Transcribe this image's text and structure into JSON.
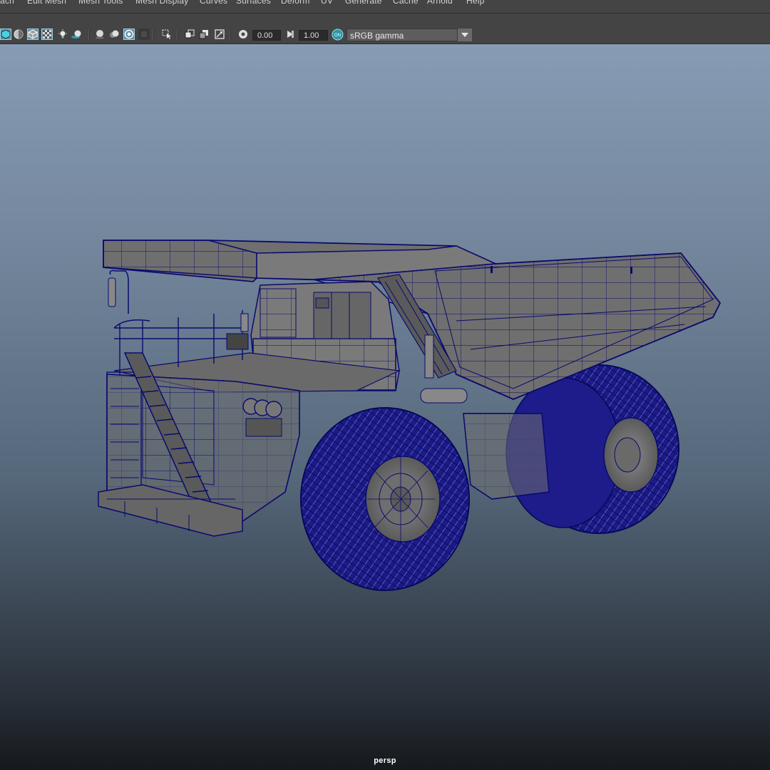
{
  "menubar": {
    "items": [
      "ach",
      "Edit Mesh",
      "Mesh Tools",
      "Mesh Display",
      "Curves",
      "Surfaces",
      "Deform",
      "UV",
      "Generate",
      "Cache",
      "Arnold",
      "Help"
    ]
  },
  "toolbar": {
    "exposure_value": "0.00",
    "gamma_value": "1.00",
    "view_transform_badge": "ON",
    "color_space": "sRGB gamma"
  },
  "viewport": {
    "camera_label": "persp"
  },
  "colors": {
    "ui_dark": "#444444",
    "field_bg": "#2b2b2b",
    "wireframe": "#0a0a6e",
    "model_shade": "#6f6f6f",
    "viewport_top": "#879cb4",
    "viewport_bottom": "#16191d"
  }
}
